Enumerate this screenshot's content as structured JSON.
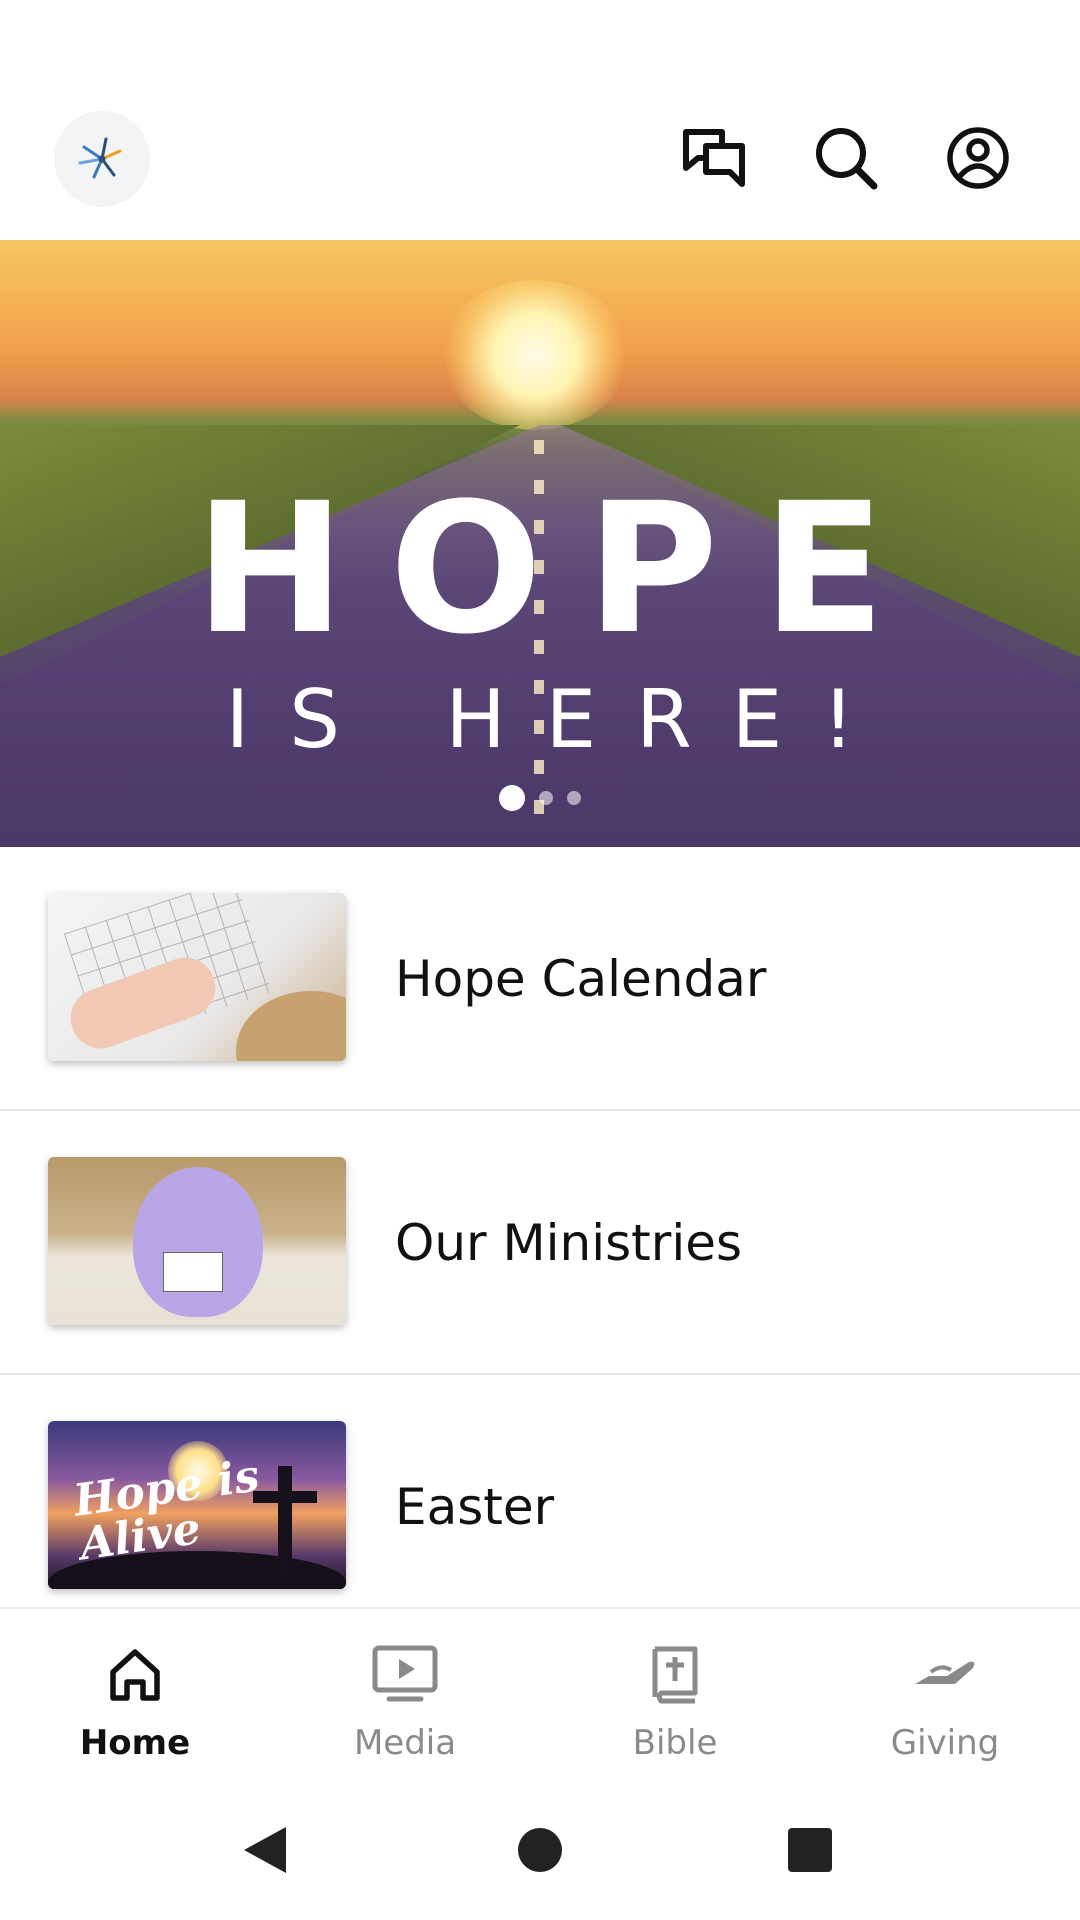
{
  "header": {
    "logo_icon": "church-logo-icon",
    "actions": [
      {
        "name": "messages-button",
        "icon": "chat-icon"
      },
      {
        "name": "search-button",
        "icon": "search-icon"
      },
      {
        "name": "profile-button",
        "icon": "account-circle-icon"
      }
    ]
  },
  "hero": {
    "title": "HOPE",
    "subtitle": "IS HERE!",
    "slides_total": 3,
    "active_slide": 1
  },
  "list": {
    "items": [
      {
        "label": "Hope Calendar"
      },
      {
        "label": "Our Ministries"
      },
      {
        "label": "Easter",
        "thumb_text": "Hope is Alive"
      }
    ]
  },
  "bottom_nav": {
    "items": [
      {
        "label": "Home",
        "icon": "home-icon",
        "active": true
      },
      {
        "label": "Media",
        "icon": "play-screen-icon",
        "active": false
      },
      {
        "label": "Bible",
        "icon": "bible-icon",
        "active": false
      },
      {
        "label": "Giving",
        "icon": "giving-hand-icon",
        "active": false
      }
    ]
  },
  "colors": {
    "active": "#111111",
    "inactive": "#8a8a8a",
    "divider": "#e6e6e6"
  }
}
